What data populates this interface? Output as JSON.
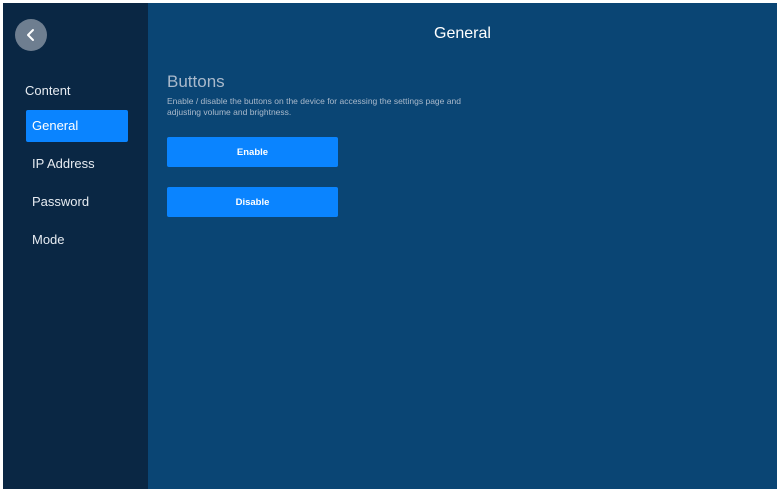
{
  "header": {
    "title": "General"
  },
  "sidebar": {
    "back_icon": "back-arrow-icon",
    "heading": "Content",
    "items": [
      {
        "label": "General",
        "active": true
      },
      {
        "label": "IP Address",
        "active": false
      },
      {
        "label": "Password",
        "active": false
      },
      {
        "label": "Mode",
        "active": false
      }
    ]
  },
  "main": {
    "section": {
      "title": "Buttons",
      "description": "Enable / disable the buttons on the device for accessing the settings page and adjusting volume and brightness."
    },
    "enable_label": "Enable",
    "disable_label": "Disable"
  },
  "colors": {
    "sidebar_bg": "#0a2744",
    "main_bg": "#0a4574",
    "accent": "#0a84ff"
  }
}
